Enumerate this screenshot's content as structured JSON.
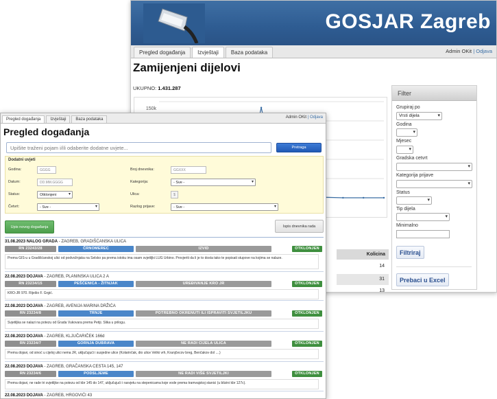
{
  "back_window": {
    "brand": "GOSJAR Zagreb",
    "tabs": [
      {
        "label": "Pregled događanja",
        "active": false
      },
      {
        "label": "Izvještaji",
        "active": true
      },
      {
        "label": "Baza podataka",
        "active": false
      }
    ],
    "user": "Admin OKit",
    "separator": "|",
    "logout": "Odjava",
    "page_title": "Zamijenjeni dijelovi",
    "total_label": "UKUPNO:",
    "total_value": "1.431.287",
    "chart_tick": "150k",
    "table_header": "Kolicina",
    "table_values": [
      "14",
      "31",
      "13"
    ],
    "filter": {
      "title": "Filter",
      "group_label": "Grupiraj po",
      "group_value": "Vrsti dijela",
      "year_label": "Godina",
      "month_label": "Mjesec",
      "district_label": "Gradska cetvrt",
      "category_label": "Kategorija prijave",
      "status_label": "Status",
      "part_type_label": "Tip dijela",
      "minimum_label": "Minimalno",
      "apply_button": "Filtriraj",
      "excel_button": "Prebaci u Excel"
    }
  },
  "chart_data": {
    "type": "line",
    "title": "",
    "xlabel": "",
    "ylabel": "",
    "y_ticks": [
      "150k"
    ],
    "grid": true,
    "note_values": "series mostly near zero with one spike near 150k; values not individually labeled",
    "series": [
      {
        "values": [
          0,
          0,
          2000,
          0,
          0,
          150000,
          0,
          0,
          1000,
          0,
          0,
          0
        ]
      }
    ]
  },
  "front_window": {
    "tabs": [
      {
        "label": "Pregled događanja",
        "active": true
      },
      {
        "label": "Izvještaji",
        "active": false
      },
      {
        "label": "Baza podataka",
        "active": false
      }
    ],
    "user": "Admin OKit",
    "separator": "|",
    "logout": "Odjava",
    "page_title": "Pregled događanja",
    "search_placeholder": "Upišite traženi pojam i/ili odaberite dodatne uvjete...",
    "search_button": "Pretraga",
    "extra_conditions": {
      "title": "Dodatni uvjeti",
      "year_label": "Godina:",
      "year_placeholder": "GGGG",
      "date_label": "Datum:",
      "date_placeholder": "DD.MM.GGGG",
      "status_label": "Status:",
      "status_value": "Otklonjeni",
      "district_label": "Četvrt:",
      "district_value": "- Sve -",
      "log_label": "Broj dnevnika:",
      "log_placeholder": "GGXXX",
      "category_label": "Kategorija:",
      "category_value": "- Sve -",
      "street_label": "Ulica:",
      "reason_label": "Razlog prijave:",
      "reason_value": "- Sve -"
    },
    "new_event_button": "Upis novog događanja",
    "print_log_button": "Ispis dnevnika rada",
    "entries": [
      {
        "header_bold": "31.08.2023 NALOG GRADA",
        "header_rest": " - ZAGREB, GRADIŠĆANSKA ULICA",
        "rn": "RN 23243/28",
        "district": "ČRNOMEREC",
        "category": "IZVID",
        "status": "OTKLONJEN",
        "description": "Prema GIS-u u Gradišćanskoj ulici od podvožnjaka na Selsko pa prema istoku ima osam svjetiljki LUG Urbino. Provjeriti da li je to dosta tako te popisati stupove na kojima se nalaze."
      },
      {
        "header_bold": "22.08.2023 DOJAVA",
        "header_rest": " - ZAGREB, PLANINSKA ULICA 2 A",
        "rn": "RN 23234/15",
        "district": "PEŠĆENICA - ŽITNJAK",
        "category": "UREĐIVANJE KRO JR",
        "status": "OTKLONJEN",
        "description": "KRO-JR 970. Riješio F. Grgić."
      },
      {
        "header_bold": "22.08.2023 DOJAVA",
        "header_rest": " - ZAGREB, AVENIJA MARINA DRŽIĆA",
        "rn": "RN 23234/8",
        "district": "TRNJE",
        "category": "POTREBNO OKRENUTI ILI ISPRAVITI SVJETILJKU",
        "status": "OTKLONJEN",
        "description": "Svjetiljka se nalazi na potezu od Grada Vukovara prema Petiji. Slika u prilogu."
      },
      {
        "header_bold": "22.08.2023 DOJAVA",
        "header_rest": " - ZAGREB, KLJUČARIČEK 166d",
        "rn": "RN 23234/7",
        "district": "GORNJA DUBRAVA",
        "category": "NE RADI CIJELA ULICA",
        "status": "OTKLONJEN",
        "description": "Prema dojavi, od sinoć u cijeloj ulici nema JR, uključujući i susjedne ulice (Kolarinčak, dio ulice Veliki vrh, Kranjčecov breg, Benčakov dol ....)"
      },
      {
        "header_bold": "22.08.2023 DOJAVA",
        "header_rest": " - ZAGREB, GRAČANSKA CESTA 145, 147",
        "rn": "RN 23234/6",
        "district": "PODSLJEME",
        "category": "NE RADI VIŠE SVJETILJKI",
        "status": "OTKLONJEN",
        "description": "Prema dojavi, ne rade tri svjetiljke na potezu od kbr 145 do 147, uključujući i rasvjetu na stepenicama koje vode prema tramvajskoj stanici (u blizini kbr 127c)."
      },
      {
        "header_bold": "22.08.2023 DOJAVA",
        "header_rest": " - ZAGREB, HRGOVIĆI 43"
      }
    ]
  }
}
